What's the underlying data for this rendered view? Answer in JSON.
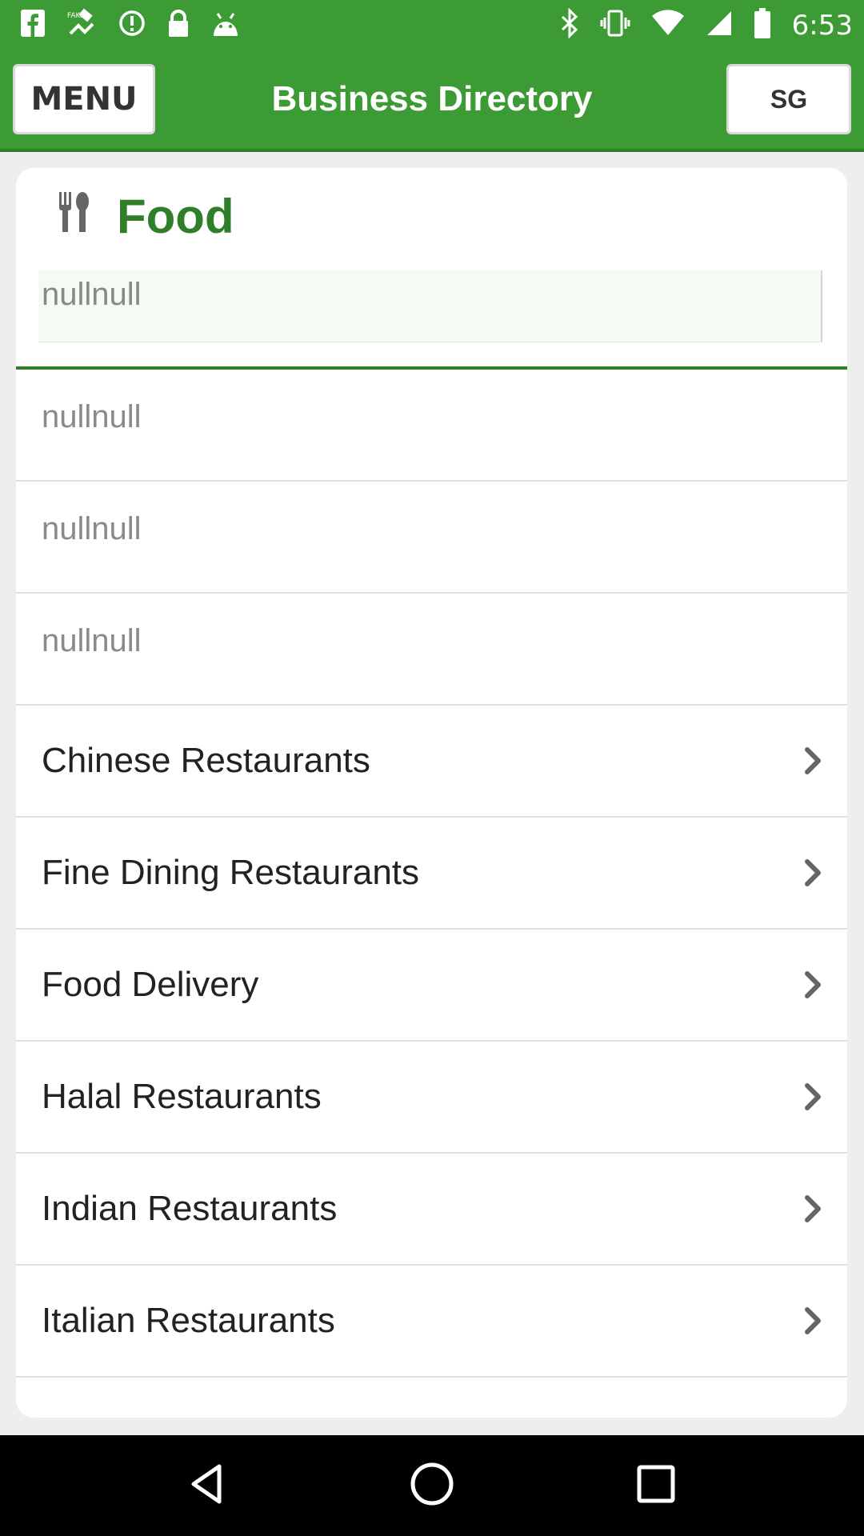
{
  "status_bar": {
    "time": "6:53",
    "left_icons": [
      "facebook-icon",
      "fake-gps-icon",
      "info-icon",
      "lock-icon",
      "android-icon"
    ],
    "right_icons": [
      "bluetooth-icon",
      "vibrate-icon",
      "wifi-icon",
      "signal-icon",
      "battery-icon"
    ]
  },
  "app_bar": {
    "menu_label": "MENU",
    "title": "Business Directory",
    "region_label": "SG"
  },
  "category": {
    "icon": "fork-spoon-icon",
    "title": "Food",
    "subtitle": "nullnull"
  },
  "rows": [
    {
      "label": "nullnull",
      "type": "null"
    },
    {
      "label": "nullnull",
      "type": "null"
    },
    {
      "label": "nullnull",
      "type": "null"
    },
    {
      "label": "Chinese Restaurants",
      "type": "link"
    },
    {
      "label": "Fine Dining Restaurants",
      "type": "link"
    },
    {
      "label": "Food Delivery",
      "type": "link"
    },
    {
      "label": "Halal Restaurants",
      "type": "link"
    },
    {
      "label": "Indian Restaurants",
      "type": "link"
    },
    {
      "label": "Italian Restaurants",
      "type": "link"
    }
  ],
  "nav_bar": [
    "back-icon",
    "home-icon",
    "recents-icon"
  ],
  "colors": {
    "primary_green": "#3d9b35",
    "dark_green": "#2f7f2a"
  }
}
